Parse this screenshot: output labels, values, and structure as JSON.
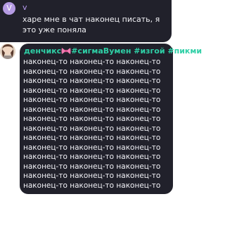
{
  "top_message": {
    "avatar_letter": "V",
    "sender": "v",
    "text": "харе мне в чат наконец писать, я это уже поняла"
  },
  "main_message": {
    "sender_name": "денчикс",
    "sender_tags": "#сигмаВумен #изгой #пикми",
    "lines": [
      "наконец-то наконец-то наконец-то",
      "наконец-то наконец-то наконец-то",
      "наконец-то наконец-то наконец-то",
      "наконец-то наконец-то наконец-то",
      "наконец-то наконец-то наконец-то",
      "наконец-то наконец-то наконец-то",
      "наконец-то наконец-то наконец-то",
      "наконец-то наконец-то наконец-то",
      "наконец-то наконец-то наконец-то",
      "наконец-то наконец-то наконец-то",
      "наконец-то наконец-то наконец-то",
      "наконец-то наконец-то наконец-то",
      "наконец-то наконец-то наконец-то",
      "наконец-то наконец-то наконец-то"
    ]
  },
  "colors": {
    "bubble": "#21212b",
    "sender_top": "#b79bf0",
    "sender_main": "#2fcfa6",
    "avatar_v": "#b59be3",
    "text": "#f3f3f8"
  },
  "icons": {
    "bow": "pink-bow-emoji"
  }
}
